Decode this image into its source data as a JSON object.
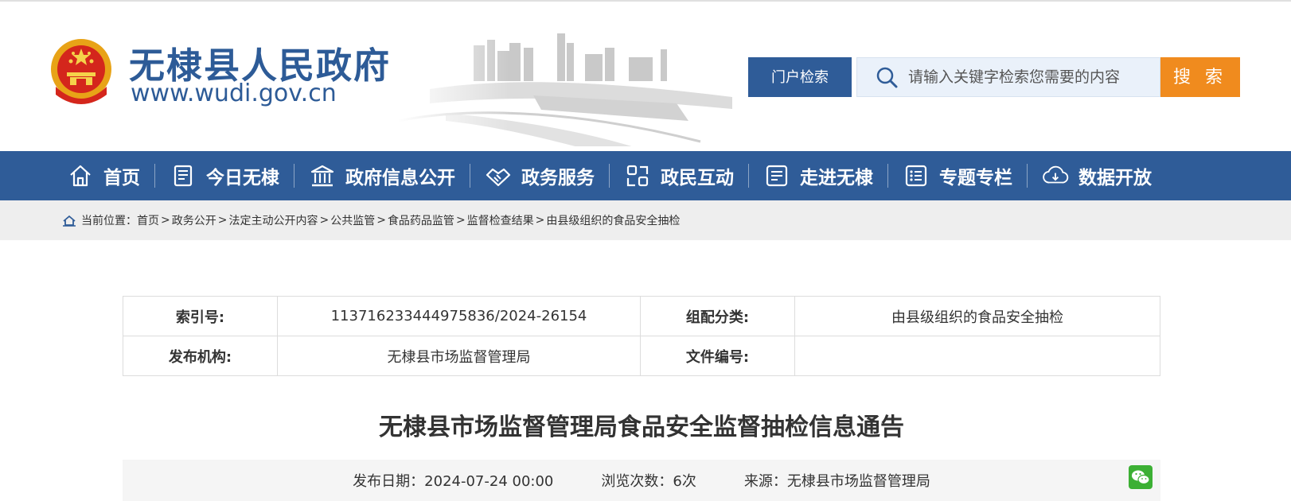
{
  "header": {
    "site_name": "无棣县人民政府",
    "site_url": "www.wudi.gov.cn",
    "portal_search_label": "门户检索",
    "search_placeholder": "请输入关键字检索您需要的内容",
    "search_button_label": "搜 索"
  },
  "nav": {
    "items": [
      {
        "label": "首页",
        "icon": "home-icon"
      },
      {
        "label": "今日无棣",
        "icon": "news-icon"
      },
      {
        "label": "政府信息公开",
        "icon": "building-icon"
      },
      {
        "label": "政务服务",
        "icon": "handshake-icon"
      },
      {
        "label": "政民互动",
        "icon": "interaction-icon"
      },
      {
        "label": "走进无棣",
        "icon": "id-card-icon"
      },
      {
        "label": "专题专栏",
        "icon": "list-icon"
      },
      {
        "label": "数据开放",
        "icon": "cloud-download-icon"
      }
    ]
  },
  "breadcrumb": {
    "prefix": "当前位置：",
    "items": [
      "首页",
      "政务公开",
      "法定主动公开内容",
      "公共监管",
      "食品药品监管",
      "监督检查结果",
      "由县级组织的食品安全抽检"
    ]
  },
  "meta": {
    "index_label": "索引号:",
    "index_value": "11371623344497583​6/2024-26154",
    "category_label": "组配分类:",
    "category_value": "由县级组织的食品安全抽检",
    "publisher_label": "发布机构:",
    "publisher_value": "无棣县市场监督管理局",
    "doc_number_label": "文件编号:",
    "doc_number_value": ""
  },
  "article": {
    "title": "无棣县市场监督管理局食品安全监督抽检信息通告",
    "date_label": "发布日期：",
    "date_value": "2024-07-24 00:00",
    "views_label": "浏览次数：",
    "views_value": "6次",
    "source_label": "来源：",
    "source_value": "无棣县市场监督管理局"
  },
  "colors": {
    "brand_blue": "#2f5c98",
    "search_orange": "#f08b1e"
  }
}
